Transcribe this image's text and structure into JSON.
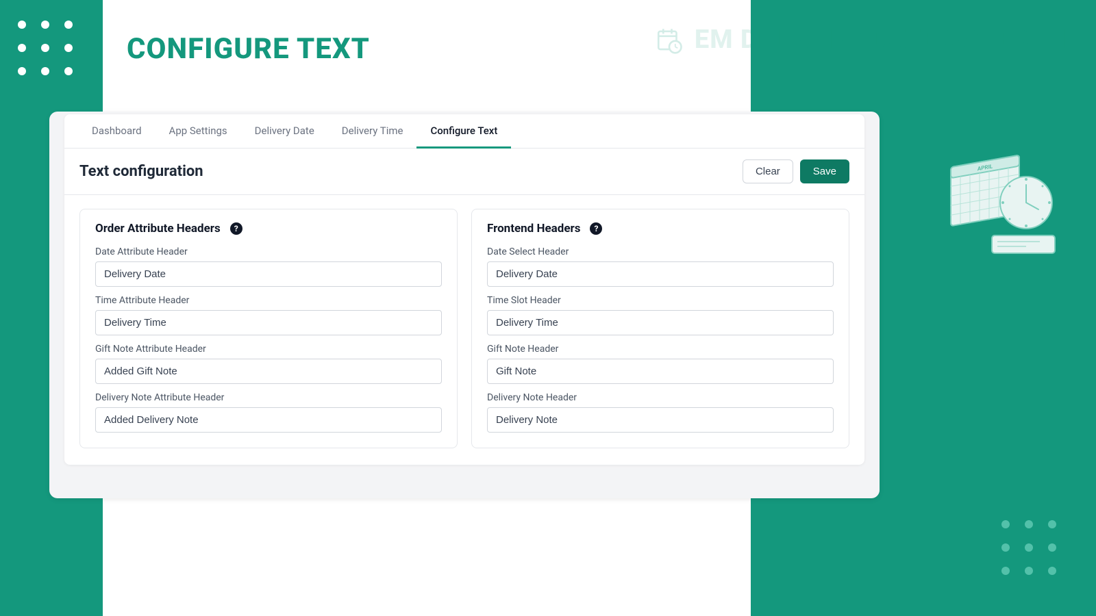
{
  "header": {
    "page_title": "CONFIGURE TEXT",
    "brand_text": "EM DELIVERY DATE SCHEDULER"
  },
  "tabs": [
    {
      "label": "Dashboard",
      "active": false
    },
    {
      "label": "App Settings",
      "active": false
    },
    {
      "label": "Delivery Date",
      "active": false
    },
    {
      "label": "Delivery Time",
      "active": false
    },
    {
      "label": "Configure Text",
      "active": true
    }
  ],
  "section": {
    "title": "Text configuration",
    "clear_label": "Clear",
    "save_label": "Save"
  },
  "panel_left": {
    "title": "Order Attribute Headers",
    "fields": [
      {
        "label": "Date Attribute Header",
        "value": "Delivery Date"
      },
      {
        "label": "Time Attribute Header",
        "value": "Delivery Time"
      },
      {
        "label": "Gift Note Attribute Header",
        "value": "Added Gift Note"
      },
      {
        "label": "Delivery Note Attribute Header",
        "value": "Added Delivery Note"
      }
    ]
  },
  "panel_right": {
    "title": "Frontend Headers",
    "fields": [
      {
        "label": "Date Select Header",
        "value": "Delivery Date"
      },
      {
        "label": "Time Slot Header",
        "value": "Delivery Time"
      },
      {
        "label": "Gift Note Header",
        "value": "Gift Note"
      },
      {
        "label": "Delivery Note Header",
        "value": "Delivery Note"
      }
    ]
  }
}
